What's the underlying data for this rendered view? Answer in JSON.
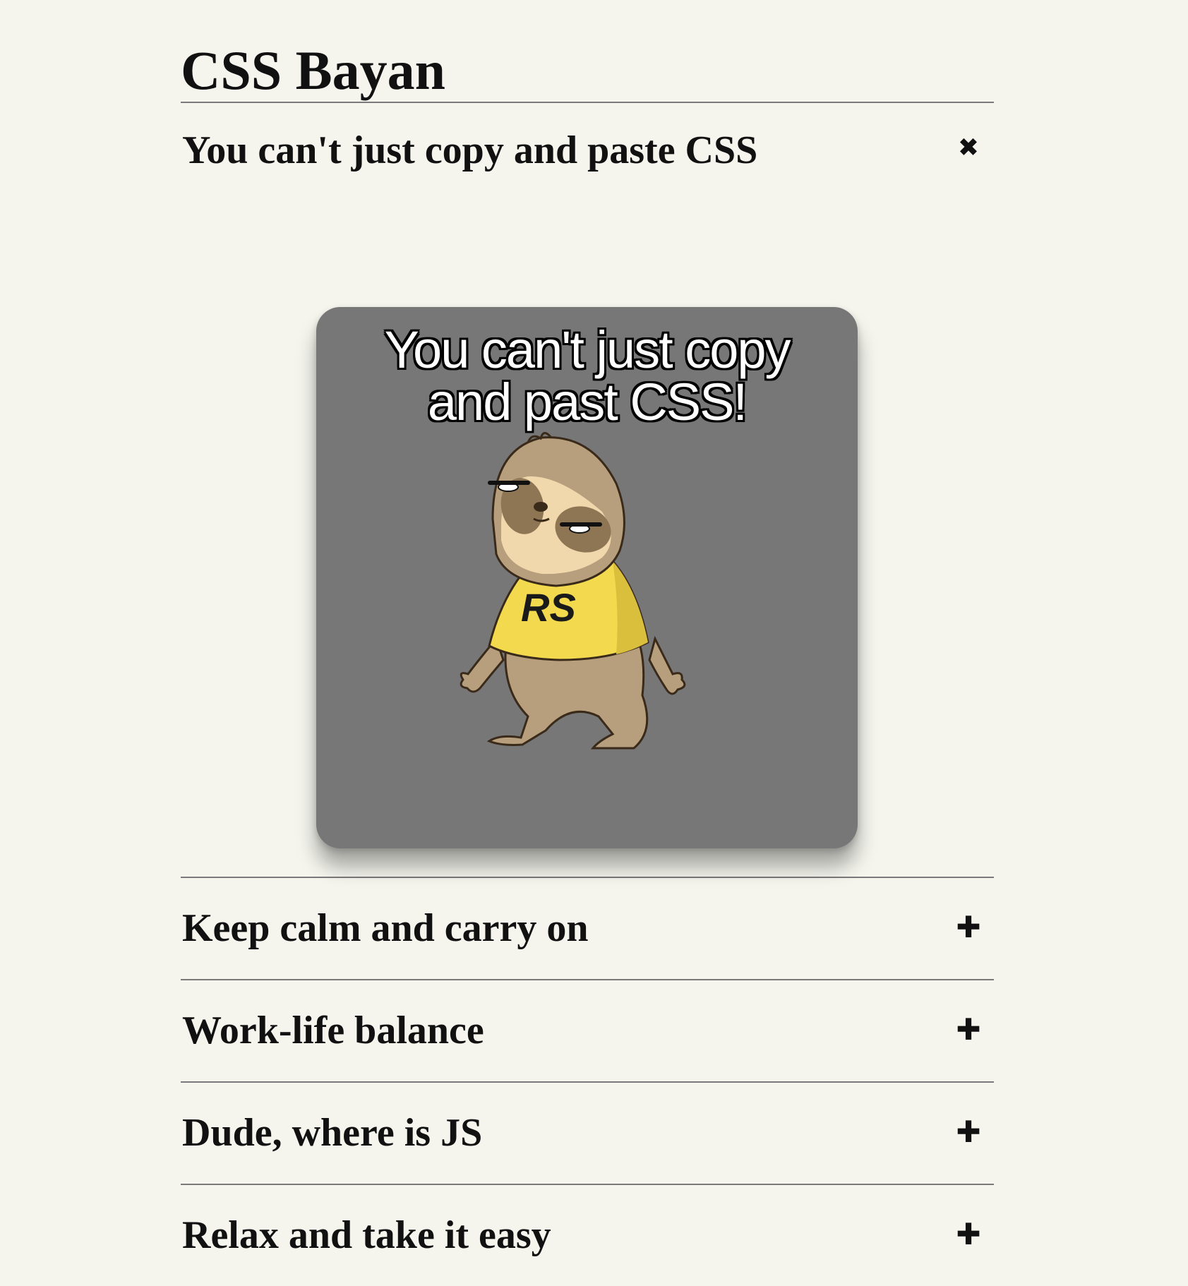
{
  "page": {
    "title": "CSS Bayan"
  },
  "accordion": {
    "items": [
      {
        "label": "You can't just copy and paste CSS",
        "expanded": true,
        "toggle_icon": "close-icon",
        "toggle_glyph": "✖",
        "panel": {
          "image_caption": "You can't just copy and past CSS!",
          "image_caption_line1": "You can't just copy",
          "image_caption_line2": "and past CSS!",
          "shirt_text": "RS"
        }
      },
      {
        "label": "Keep calm and carry on",
        "expanded": false,
        "toggle_icon": "plus-icon",
        "toggle_glyph": "✚"
      },
      {
        "label": "Work-life balance",
        "expanded": false,
        "toggle_icon": "plus-icon",
        "toggle_glyph": "✚"
      },
      {
        "label": "Dude, where is JS",
        "expanded": false,
        "toggle_icon": "plus-icon",
        "toggle_glyph": "✚"
      },
      {
        "label": "Relax and take it easy",
        "expanded": false,
        "toggle_icon": "plus-icon",
        "toggle_glyph": "✚"
      }
    ]
  },
  "colors": {
    "background": "#f5f5ee",
    "divider": "#7a7a7a",
    "card": "#777777",
    "shirt": "#f2d94e"
  }
}
